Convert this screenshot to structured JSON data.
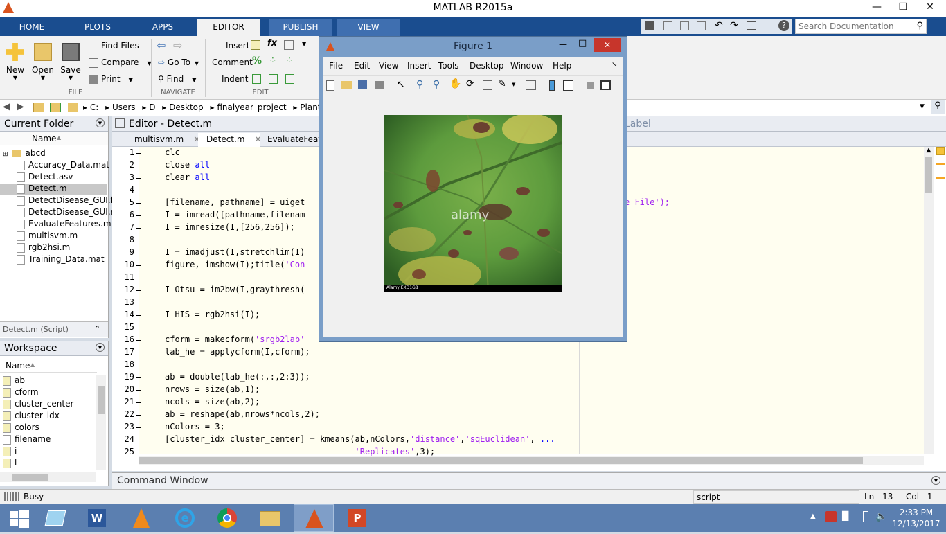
{
  "app": {
    "title": "MATLAB R2015a"
  },
  "ribbon": {
    "tabs": [
      "HOME",
      "PLOTS",
      "APPS",
      "EDITOR",
      "PUBLISH",
      "VIEW"
    ],
    "active_tab": "EDITOR",
    "file_group": {
      "new": "New",
      "open": "Open",
      "save": "Save",
      "find_files": "Find Files",
      "compare": "Compare",
      "print": "Print",
      "label": "FILE"
    },
    "navigate_group": {
      "go_to": "Go To",
      "find": "Find",
      "label": "NAVIGATE"
    },
    "edit_group": {
      "insert": "Insert",
      "comment": "Comment",
      "indent": "Indent",
      "label": "EDIT"
    }
  },
  "search": {
    "placeholder": "Search Documentation"
  },
  "address": {
    "path": [
      "C:",
      "Users",
      "D",
      "Desktop",
      "finalyear_project",
      "Plant D"
    ]
  },
  "current_folder": {
    "title": "Current Folder",
    "col_name": "Name",
    "items": [
      "abcd",
      "Accuracy_Data.mat",
      "Detect.asv",
      "Detect.m",
      "DetectDisease_GUI.fig",
      "DetectDisease_GUI.m",
      "EvaluateFeatures.m",
      "multisvm.m",
      "rgb2hsi.m",
      "Training_Data.mat"
    ],
    "selected": "Detect.m",
    "details": "Detect.m (Script)"
  },
  "workspace": {
    "title": "Workspace",
    "col_name": "Name",
    "items": [
      "ab",
      "cform",
      "cluster_center",
      "cluster_idx",
      "colors",
      "filename",
      "i",
      "l"
    ]
  },
  "editor": {
    "title": "Editor - Detect.m",
    "tabs": [
      "multisvm.m",
      "Detect.m",
      "EvaluateFeatu"
    ],
    "active_tab": "Detect.m",
    "right_label": "Label",
    "lines": [
      {
        "n": "1",
        "t": "clc"
      },
      {
        "n": "2",
        "t": "close all"
      },
      {
        "n": "3",
        "t": "clear all"
      },
      {
        "n": "4",
        "t": ""
      },
      {
        "n": "5",
        "t": "[filename, pathname] = uiget"
      },
      {
        "n": "6",
        "t": "I = imread([pathname,filenam"
      },
      {
        "n": "7",
        "t": "I = imresize(I,[256,256]);"
      },
      {
        "n": "8",
        "t": ""
      },
      {
        "n": "9",
        "t": "I = imadjust(I,stretchlim(I)"
      },
      {
        "n": "10",
        "t": "figure, imshow(I);title('Con"
      },
      {
        "n": "11",
        "t": ""
      },
      {
        "n": "12",
        "t": "I_Otsu = im2bw(I,graythresh("
      },
      {
        "n": "13",
        "t": ""
      },
      {
        "n": "14",
        "t": "I_HIS = rgb2hsi(I);"
      },
      {
        "n": "15",
        "t": ""
      },
      {
        "n": "16",
        "t": "cform = makecform('srgb2lab'"
      },
      {
        "n": "17",
        "t": "lab_he = applycform(I,cform);"
      },
      {
        "n": "18",
        "t": ""
      },
      {
        "n": "19",
        "t": "ab = double(lab_he(:,:,2:3));"
      },
      {
        "n": "20",
        "t": "nrows = size(ab,1);"
      },
      {
        "n": "21",
        "t": "ncols = size(ab,2);"
      },
      {
        "n": "22",
        "t": "ab = reshape(ab,nrows*ncols,2);"
      },
      {
        "n": "23",
        "t": "nColors = 3;"
      },
      {
        "n": "24",
        "t": "[cluster_idx cluster_center] = kmeans(ab,nColors,'distance','sqEuclidean', ..."
      },
      {
        "n": "25",
        "t": "                                      'Replicates',3);"
      }
    ],
    "line5_tail": "e File');"
  },
  "command_window": {
    "title": "Command Window"
  },
  "status": {
    "state": "Busy",
    "mode": "script",
    "ln_label": "Ln",
    "ln": "13",
    "col_label": "Col",
    "col": "1"
  },
  "figure": {
    "title": "Figure 1",
    "menu": [
      "File",
      "Edit",
      "View",
      "Insert",
      "Tools",
      "Desktop",
      "Window",
      "Help"
    ],
    "watermark": "alamy",
    "caption": "Alamy EXD1G8"
  },
  "taskbar": {
    "time": "2:33 PM",
    "date": "12/13/2017"
  },
  "colors": {
    "ribbon_tab_bg": "#1a4d8f",
    "editor_bg": "#fffef0",
    "keyword": "#0000ff",
    "string": "#a020f0",
    "taskbar": "#5b7fb0"
  }
}
